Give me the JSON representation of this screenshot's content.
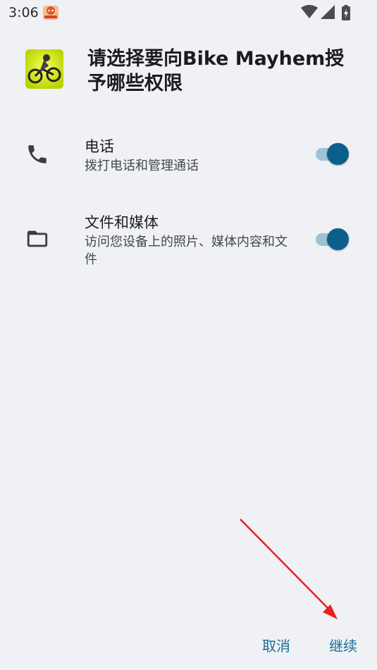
{
  "status_bar": {
    "time": "3:06",
    "icons": [
      "notification-app-icon",
      "wifi-icon",
      "signal-icon",
      "battery-charging-icon"
    ]
  },
  "dialog": {
    "app_icon": "bike-mayhem-app-icon",
    "title": "请选择要向Bike Mayhem授予哪些权限",
    "permissions": [
      {
        "icon": "phone-icon",
        "title": "电话",
        "description": "拨打电话和管理通话",
        "enabled": true
      },
      {
        "icon": "folder-icon",
        "title": "文件和媒体",
        "description": "访问您设备上的照片、媒体内容和文件",
        "enabled": true
      }
    ],
    "buttons": {
      "cancel": "取消",
      "continue": "继续"
    }
  },
  "colors": {
    "background": "#eff1f4",
    "accent": "#0b5f8d",
    "track": "#9fc3d6",
    "button_text": "#1a6d97",
    "annotation_arrow": "#e82020"
  }
}
